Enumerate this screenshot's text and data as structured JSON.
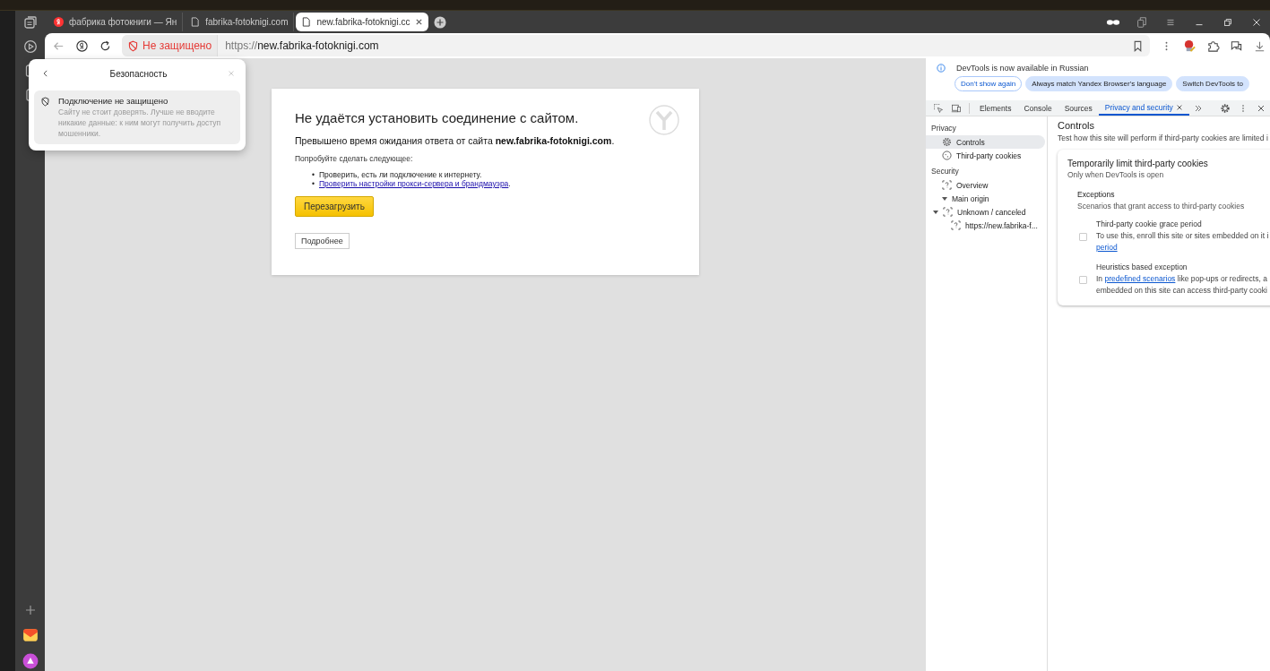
{
  "tabs": [
    {
      "title": "фабрика фотокниги — Ян",
      "kind": "yandex",
      "selected": false
    },
    {
      "title": "fabrika-fotoknigi.com",
      "kind": "page",
      "selected": false
    },
    {
      "title": "new.fabrika-fotoknigi.cc",
      "kind": "page",
      "selected": true
    }
  ],
  "address_bar": {
    "security_label": "Не защищено",
    "url_scheme": "https://",
    "url_host": "new.fabrika-fotoknigi.com"
  },
  "security_popup": {
    "title": "Безопасность",
    "heading": "Подключение не защищено",
    "text": "Сайту не стоит доверять. Лучше не вводите никакие данные: к ним могут получить доступ мошенники."
  },
  "error_page": {
    "title": "Не удаётся установить соединение с сайтом.",
    "message": "Превышено время ожидания ответа от сайта **new.fabrika-fotoknigi.com**.",
    "intro": "Попробуйте сделать следующее:",
    "suggestions": [
      {
        "kind": "text",
        "marker": "•",
        "text": "Проверить, есть ли подключение к интернету."
      },
      {
        "kind": "link",
        "marker": "•",
        "text": "Проверить настройки прокси-сервера и брандмауэра",
        "suffix": "."
      }
    ],
    "reload_button": "Перезагрузить",
    "details_button": "Подробнее"
  },
  "devtools": {
    "notice": {
      "text": "DevTools is now available in Russian",
      "buttons": [
        {
          "label": "Don't show again",
          "kind": "outline"
        },
        {
          "label": "Always match Yandex Browser's language",
          "kind": "filled"
        },
        {
          "label": "Switch DevTools to",
          "kind": "filled"
        }
      ]
    },
    "tabs": [
      {
        "label": "Elements",
        "selected": false,
        "closable": false
      },
      {
        "label": "Console",
        "selected": false,
        "closable": false
      },
      {
        "label": "Sources",
        "selected": false,
        "closable": false
      },
      {
        "label": "Privacy and security",
        "selected": true,
        "closable": true
      }
    ],
    "sidebar": [
      {
        "heading": "Privacy",
        "items": [
          {
            "label": "Controls",
            "kind": "settings",
            "selected": true
          },
          {
            "label": "Third-party cookies",
            "kind": "cookies",
            "selected": false
          }
        ]
      },
      {
        "heading": "Security",
        "items": [
          {
            "label": "Overview",
            "kind": "status",
            "selected": false
          },
          {
            "label": "Main origin",
            "kind": "group",
            "selected": false,
            "expanded": true,
            "children": [
              {
                "label": "Unknown / canceled",
                "kind": "status",
                "selected": false,
                "expanded": true,
                "children": [
                  {
                    "label": "https://new.fabrika-f...",
                    "kind": "status",
                    "selected": false
                  }
                ]
              }
            ]
          }
        ]
      }
    ],
    "main": {
      "title": "Controls",
      "description": "Test how this site will perform if third-party cookies are limited i",
      "card": {
        "title": "Temporarily limit third-party cookies",
        "subtitle": "Only when DevTools is open",
        "exceptions_title": "Exceptions",
        "exceptions_description": "Scenarios that grant access to third-party cookies",
        "options": [
          {
            "title": "Third-party cookie grace period",
            "checked": false,
            "lines": [
              [
                {
                  "text": "To use this, enroll this site or sites embedded on it i",
                  "kind": "text"
                }
              ],
              [
                {
                  "text": "period",
                  "kind": "link"
                }
              ]
            ]
          },
          {
            "title": "Heuristics based exception",
            "checked": false,
            "lines": [
              [
                {
                  "text": "In ",
                  "kind": "text"
                },
                {
                  "text": "predefined scenarios",
                  "kind": "link"
                },
                {
                  "text": " like pop-ups or redirects, a",
                  "kind": "text"
                }
              ],
              [
                {
                  "text": "embedded on this site can access third-party cooki",
                  "kind": "text"
                }
              ]
            ]
          }
        ]
      }
    }
  }
}
